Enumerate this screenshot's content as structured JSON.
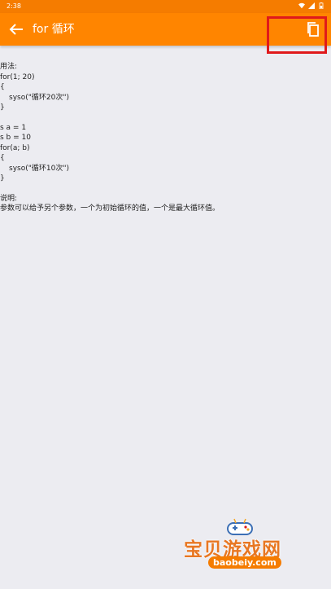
{
  "statusbar": {
    "time": "2:38"
  },
  "appbar": {
    "title": "for 循环",
    "back_icon": "arrow-left-icon",
    "copy_icon": "copy-icon"
  },
  "content": {
    "usage_label": "用法:",
    "block1": {
      "line1": "for(1; 20)",
      "open": "{",
      "body": "syso(\"循环20次\")",
      "close": "}"
    },
    "block2": {
      "line1": "s a = 1",
      "line2": "s b = 10",
      "line3": "for(a; b)",
      "open": "{",
      "body": "syso(\"循环10次\")",
      "close": "}"
    },
    "note_label": "说明:",
    "note_text": "参数可以给予另个参数，一个为初始循环的值，一个是最大循环值。"
  },
  "watermark": {
    "title": "宝贝游戏网",
    "url": "baobeiy.com"
  },
  "colors": {
    "appbar": "#ff8500",
    "background": "#ececf1",
    "highlight": "#e0191b"
  }
}
